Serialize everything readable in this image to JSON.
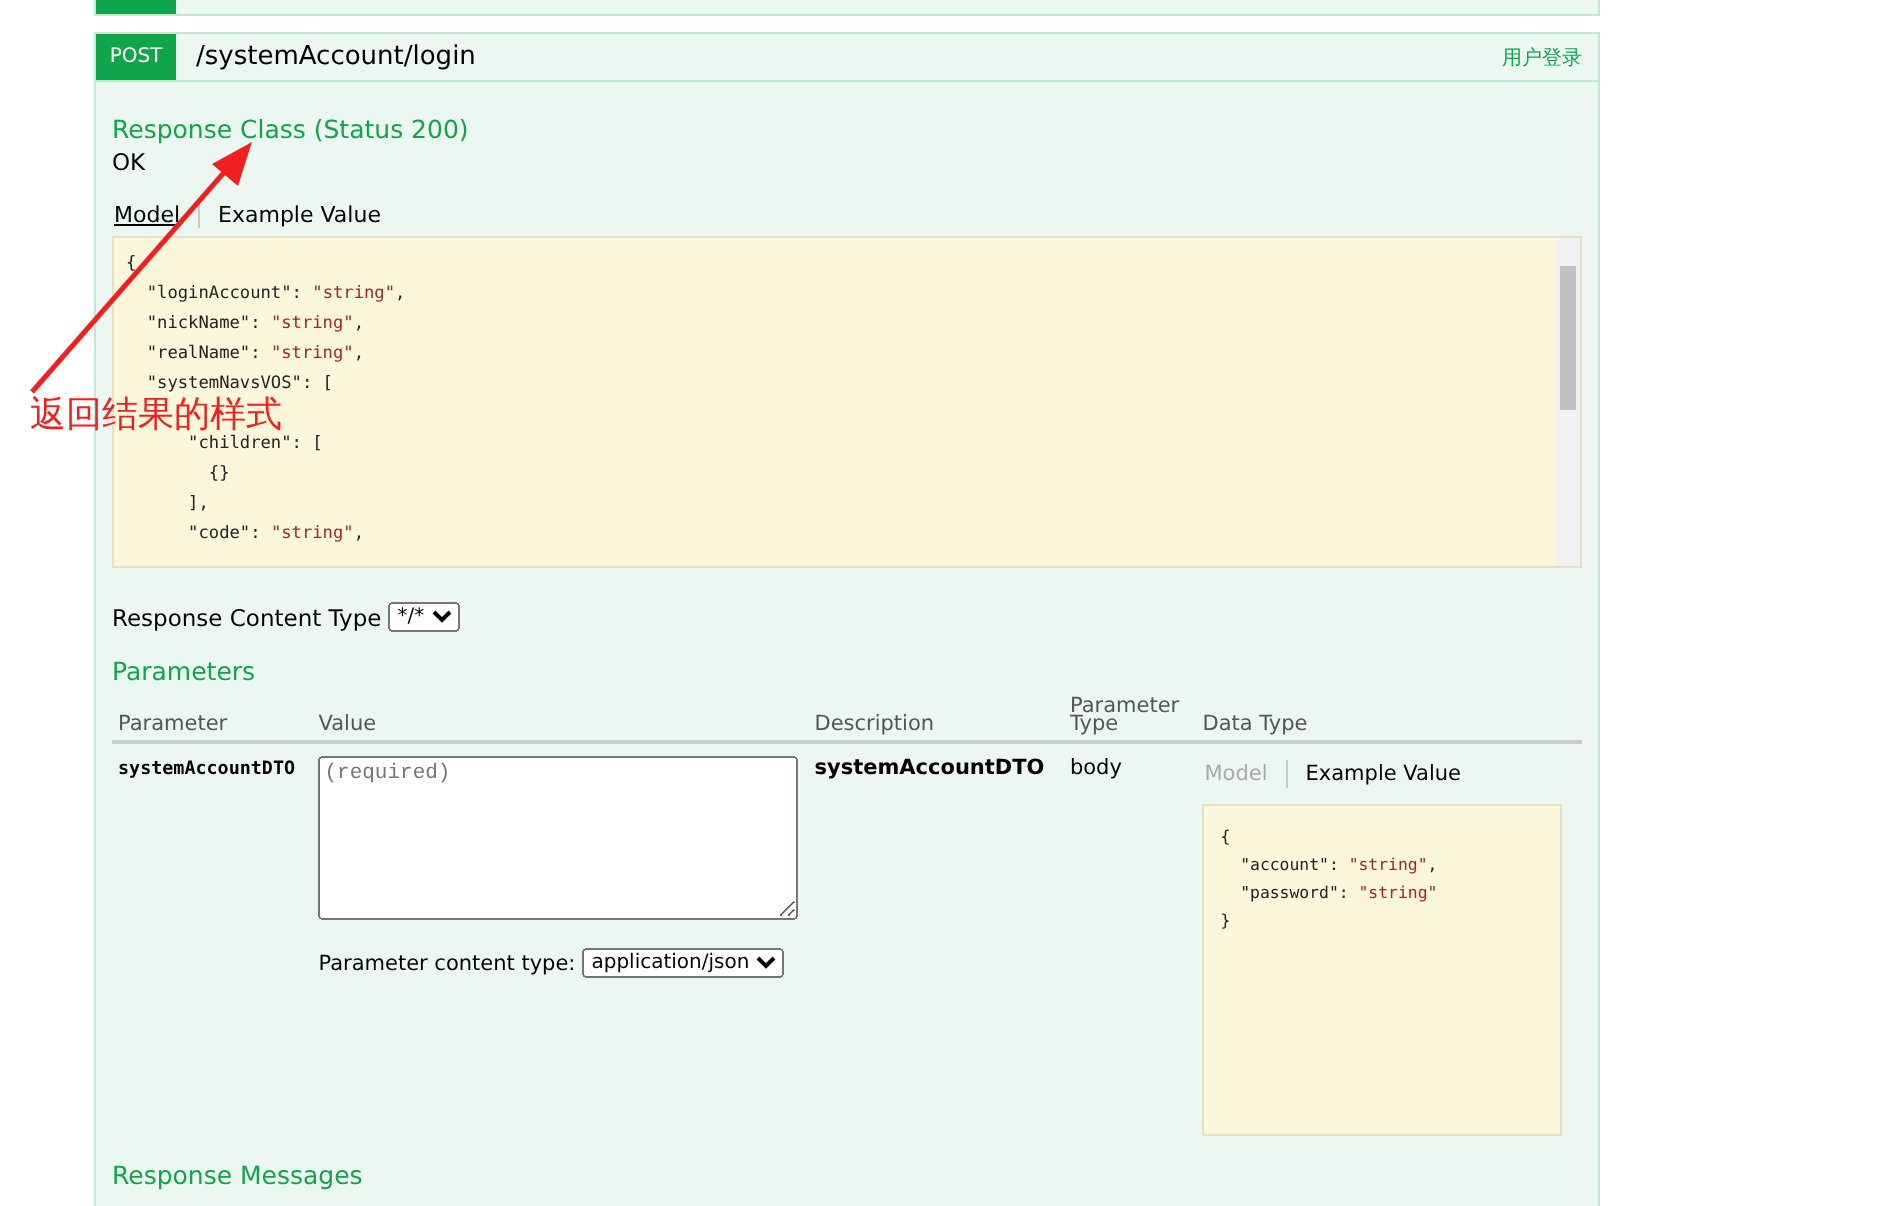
{
  "endpoint": {
    "method": "POST",
    "path": "/systemAccount/login",
    "summary": "用户登录"
  },
  "response_class": {
    "title": "Response Class (Status 200)",
    "status_text": "OK",
    "tabs": [
      {
        "label": "Model",
        "selected": true
      },
      {
        "label": "Example Value",
        "selected": false
      }
    ],
    "code_lines": [
      {
        "text": "{"
      },
      {
        "text": "  \"loginAccount\": ",
        "value": "\"string\"",
        "end": ","
      },
      {
        "text": "  \"nickName\": ",
        "value": "\"string\"",
        "end": ","
      },
      {
        "text": "  \"realName\": ",
        "value": "\"string\"",
        "end": ","
      },
      {
        "text": "  \"systemNavsVOS\": ["
      },
      {
        "text": "      \"children\": ["
      },
      {
        "text": "        {}"
      },
      {
        "text": "      ],"
      },
      {
        "text": "      \"code\": ",
        "value": "\"string\"",
        "end": ","
      }
    ]
  },
  "response_content_type": {
    "label": "Response Content Type",
    "value": "*/*"
  },
  "parameters": {
    "title": "Parameters",
    "columns": [
      "Parameter",
      "Value",
      "Description",
      "Parameter Type",
      "Data Type"
    ],
    "rows": [
      {
        "name": "systemAccountDTO",
        "placeholder": "(required)",
        "content_type_label": "Parameter content type:",
        "content_type": "application/json",
        "description": "systemAccountDTO",
        "param_type": "body",
        "tabs": [
          {
            "label": "Model",
            "selected": false
          },
          {
            "label": "Example Value",
            "selected": true
          }
        ],
        "code_lines": [
          {
            "text": "{"
          },
          {
            "text": "  \"account\": ",
            "value": "\"string\"",
            "end": ","
          },
          {
            "text": "  \"password\": ",
            "value": "\"string\""
          },
          {
            "text": "}"
          }
        ]
      }
    ]
  },
  "response_messages": {
    "title": "Response Messages"
  },
  "annotation": {
    "text": "返回结果的样式"
  }
}
